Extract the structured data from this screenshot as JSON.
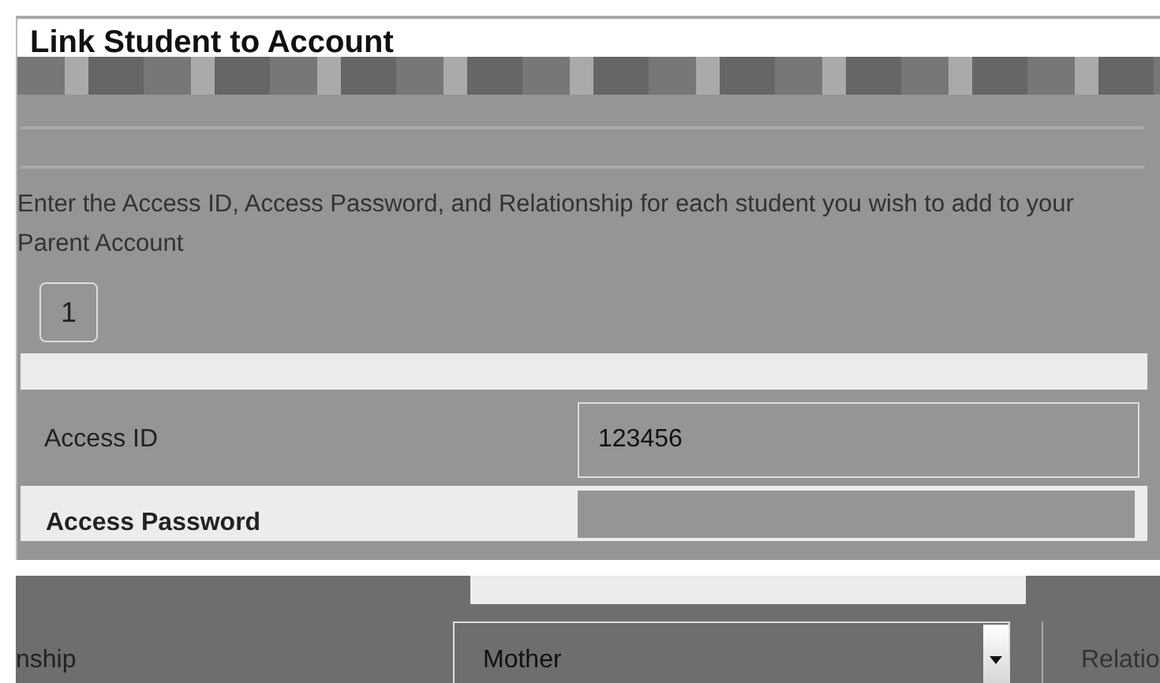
{
  "title": "Link Student to Account",
  "instructions": "Enter the Access ID, Access Password, and Relationship for each student you wish to add to your Parent Account",
  "student_number": "1",
  "fields": [
    {
      "label": "Access ID",
      "value": "123456"
    },
    {
      "label": "Access Password"
    }
  ],
  "relationship": {
    "label": "nship",
    "value": "Mother",
    "next_label": "Relatio"
  }
}
